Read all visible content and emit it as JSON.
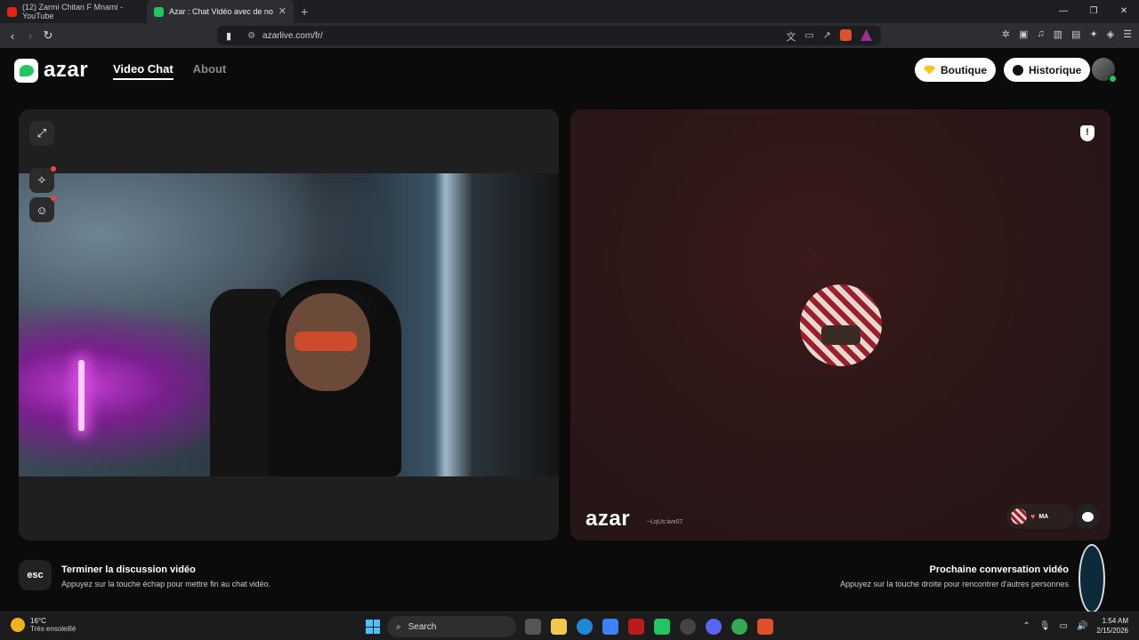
{
  "browser": {
    "tabs": [
      {
        "title": "(12) Zarmi Chitan F Mnami - YouTube",
        "active": false
      },
      {
        "title": "Azar : Chat Vidéo avec de no",
        "active": true
      }
    ],
    "url": "azarlive.com/fr/"
  },
  "app": {
    "logo_text": "azar",
    "nav": {
      "video_chat": "Video Chat",
      "about": "About"
    },
    "boutique_label": "Boutique",
    "historique_label": "Historique"
  },
  "partner": {
    "watermark": "azar",
    "watermark_id": "~LqUs:iwx07",
    "country": "MA"
  },
  "footer": {
    "esc_key": "esc",
    "end_title": "Terminer la discussion vidéo",
    "end_sub": "Appuyez sur la touche échap pour mettre fin au chat vidéo.",
    "next_title": "Prochaine conversation vidéo",
    "next_sub": "Appuyez sur la touche droite pour rencontrer d'autres personnes"
  },
  "taskbar": {
    "temp": "16°C",
    "condition": "Très ensoleillé",
    "search_label": "Search",
    "time": "1:54 AM",
    "date": "2/15/2026"
  },
  "colors": {
    "accent": "#22c55e",
    "boutique_gem": "#f5c518"
  }
}
